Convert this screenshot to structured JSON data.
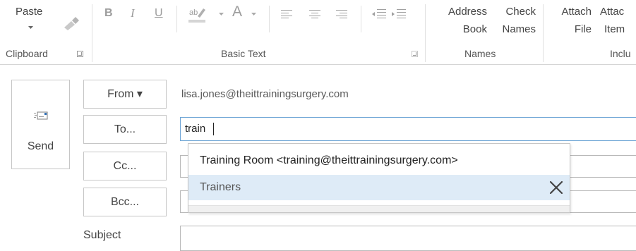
{
  "ribbon": {
    "clipboard": {
      "paste_label": "Paste",
      "group_label": "Clipboard"
    },
    "basic_text": {
      "bold": "B",
      "italic": "I",
      "underline": "U",
      "font_color": "A",
      "group_label": "Basic Text"
    },
    "names": {
      "address_book": [
        "Address",
        "Book"
      ],
      "check_names": [
        "Check",
        "Names"
      ],
      "group_label": "Names"
    },
    "include": {
      "attach_file": [
        "Attach",
        "File"
      ],
      "attach_item": [
        "Attac",
        "Item"
      ],
      "group_label": "Inclu"
    }
  },
  "compose": {
    "send_label": "Send",
    "from_button": "From ▾",
    "from_address": "lisa.jones@theittrainingsurgery.com",
    "to_button": "To...",
    "to_value": "train",
    "cc_button": "Cc...",
    "bcc_button": "Bcc...",
    "subject_label": "Subject"
  },
  "autocomplete": {
    "items": [
      {
        "label": "Training Room <training@theittrainingsurgery.com>",
        "selected": false
      },
      {
        "label": "Trainers",
        "selected": true
      }
    ]
  },
  "colors": {
    "selection": "#deebf7",
    "focus_border": "#6fa6d6"
  }
}
